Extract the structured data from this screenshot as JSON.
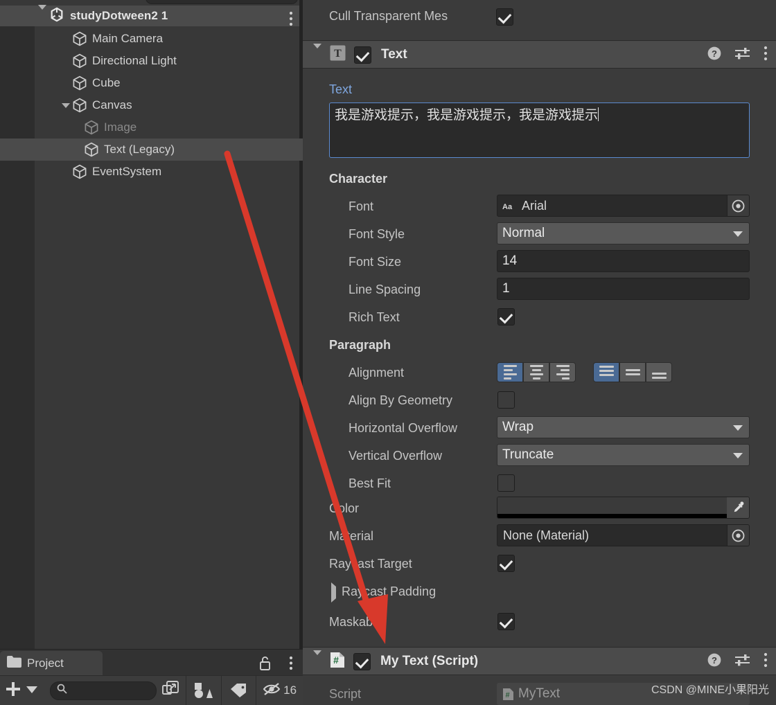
{
  "hierarchy": {
    "scene": {
      "name": "studyDotween2 1",
      "foldout": "triangle-down-icon",
      "menu": "kebab-menu-icon",
      "unity_icon": "unity-logo-icon"
    },
    "items": [
      {
        "label": "Main Camera",
        "indent": 2,
        "foldout": "none",
        "selected": false,
        "dim": false
      },
      {
        "label": "Directional Light",
        "indent": 2,
        "foldout": "none",
        "selected": false,
        "dim": false
      },
      {
        "label": "Cube",
        "indent": 2,
        "foldout": "none",
        "selected": false,
        "dim": false
      },
      {
        "label": "Canvas",
        "indent": 2,
        "foldout": "triangle-down",
        "selected": false,
        "dim": false
      },
      {
        "label": "Image",
        "indent": 3,
        "foldout": "none",
        "selected": false,
        "dim": true
      },
      {
        "label": "Text (Legacy)",
        "indent": 3,
        "foldout": "none",
        "selected": true,
        "dim": false
      },
      {
        "label": "EventSystem",
        "indent": 2,
        "foldout": "none",
        "selected": false,
        "dim": false
      }
    ]
  },
  "project_panel": {
    "tab_label": "Project",
    "folder_icon": "folder-icon",
    "lock_icon": "lock-open-icon",
    "menu_icon": "kebab-menu-icon",
    "toolbar": {
      "add_icon": "plus-icon",
      "add_dropdown_icon": "caret-down-icon",
      "search_icon": "search-icon",
      "search_value": "",
      "search_placeholder": "",
      "expand_icon": "open-in-new-icon",
      "shapes_icon": "shapes-filter-icon",
      "label_icon": "tag-filter-icon",
      "hidden_icon": "eye-slash-icon",
      "hidden_count": "16"
    }
  },
  "inspector": {
    "cull": {
      "label": "Cull Transparent Mes",
      "checked": true
    },
    "text_component": {
      "icon": "text-component-icon",
      "icon_glyph": "T",
      "title": "Text",
      "enabled": true,
      "foldout": "triangle-down",
      "help_icon": "help-icon",
      "preset_icon": "preset-settings-icon",
      "menu_icon": "kebab-menu-icon",
      "text_field": {
        "label": "Text",
        "value": "我是游戏提示，我是游戏提示，我是游戏提示"
      },
      "character": {
        "section": "Character",
        "font": {
          "label": "Font",
          "value": "Arial",
          "glyph": "Aa",
          "picker_icon": "object-picker-icon"
        },
        "font_style": {
          "label": "Font Style",
          "value": "Normal"
        },
        "font_size": {
          "label": "Font Size",
          "value": "14"
        },
        "line_spacing": {
          "label": "Line Spacing",
          "value": "1"
        },
        "rich_text": {
          "label": "Rich Text",
          "checked": true
        }
      },
      "paragraph": {
        "section": "Paragraph",
        "alignment": {
          "label": "Alignment",
          "horizontal_options": [
            "align-left",
            "align-center",
            "align-right"
          ],
          "horizontal_selected": 0,
          "vertical_options": [
            "align-top",
            "align-middle",
            "align-bottom"
          ],
          "vertical_selected": 0
        },
        "align_by_geometry": {
          "label": "Align By Geometry",
          "checked": false
        },
        "horizontal_overflow": {
          "label": "Horizontal Overflow",
          "value": "Wrap"
        },
        "vertical_overflow": {
          "label": "Vertical Overflow",
          "value": "Truncate"
        },
        "best_fit": {
          "label": "Best Fit",
          "checked": false
        }
      },
      "color": {
        "label": "Color",
        "value": "#3a3a3a",
        "alpha_color": "#000000",
        "eyedropper_icon": "eyedropper-icon"
      },
      "material": {
        "label": "Material",
        "value": "None (Material)",
        "picker_icon": "object-picker-icon"
      },
      "raycast_target": {
        "label": "Raycast Target",
        "checked": true
      },
      "raycast_padding": {
        "label": "Raycast Padding",
        "foldout": "triangle-right"
      },
      "maskable": {
        "label": "Maskable",
        "checked": true
      }
    },
    "script_component": {
      "icon": "cs-script-icon",
      "icon_glyph": "#",
      "title": "My Text (Script)",
      "enabled": true,
      "foldout": "triangle-down",
      "help_icon": "help-icon",
      "preset_icon": "preset-settings-icon",
      "menu_icon": "kebab-menu-icon",
      "script_row": {
        "label": "Script",
        "value": "MyText",
        "glyph": "#"
      }
    },
    "scrollbar": "vertical-scrollbar"
  },
  "annotation": {
    "arrow": "red-annotation-arrow",
    "color": "#d8392b"
  },
  "watermark": {
    "text": "CSDN @MINE小果阳光"
  },
  "theme": {
    "panel_bg": "#3b3b3b",
    "header_bg": "#4b4b4b",
    "accent_blue": "#4a6a94",
    "field_bg": "#2a2a2a",
    "text_primary": "#d2d2d2"
  }
}
